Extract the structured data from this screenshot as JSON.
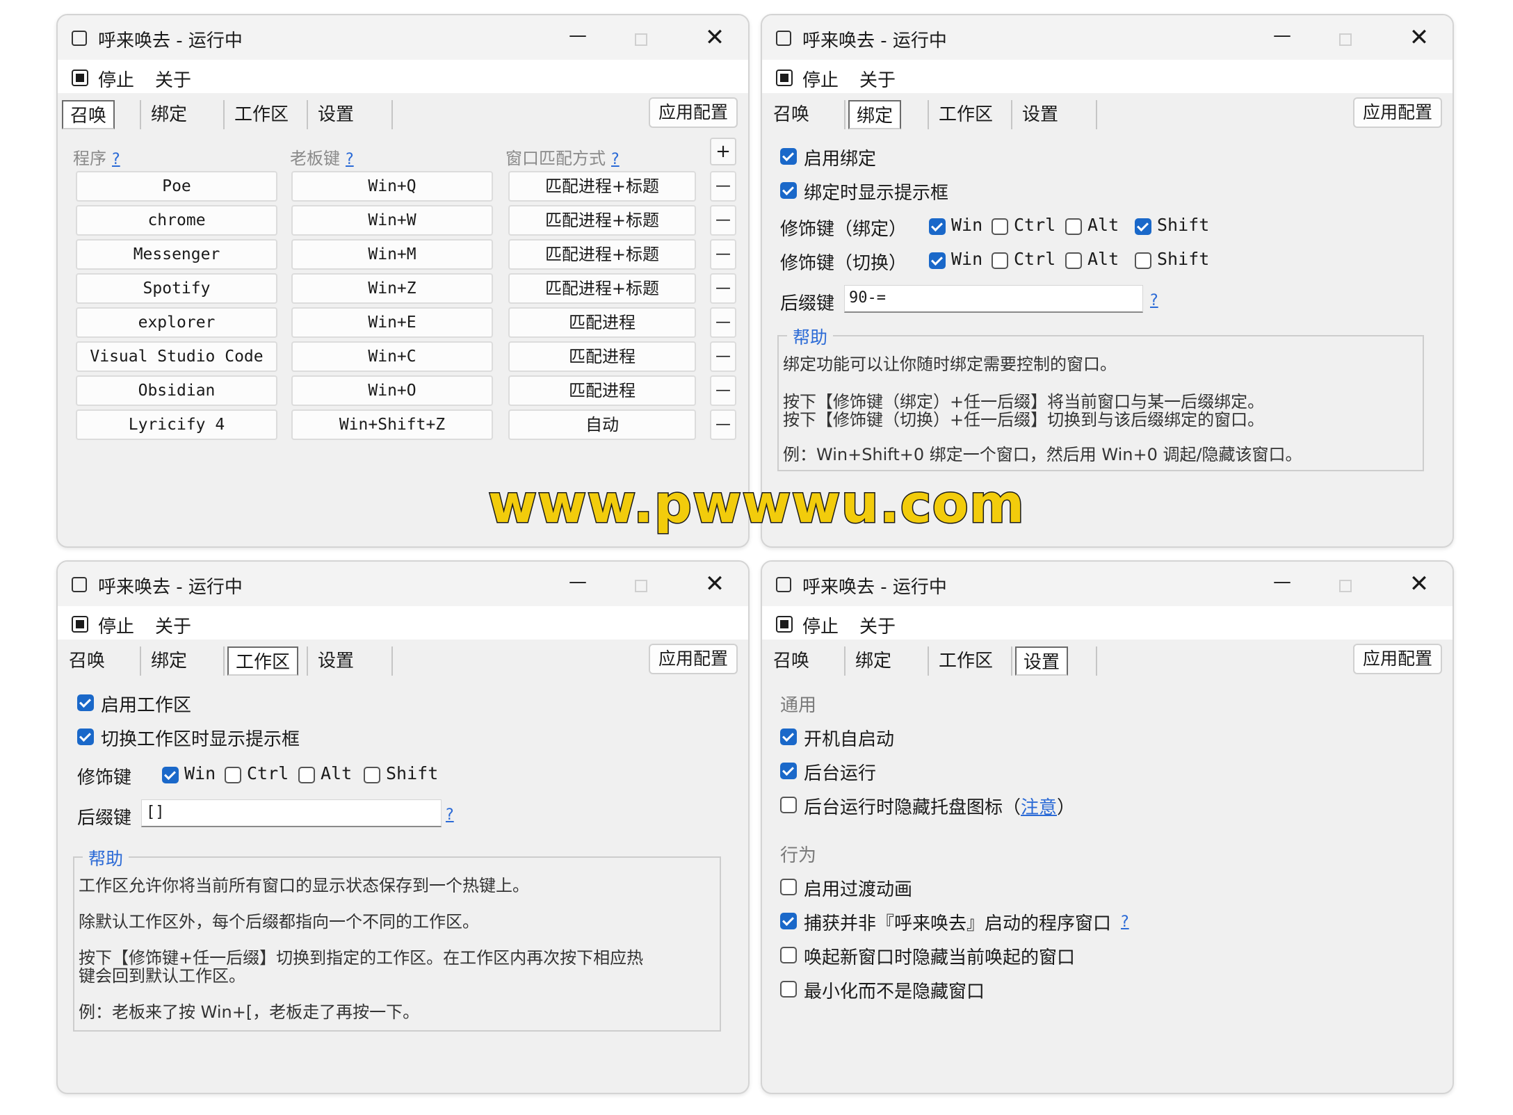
{
  "window": {
    "title": "呼来唤去 - 运行中",
    "menu": {
      "stop": "停止",
      "about": "关于"
    },
    "tabs": [
      "召唤",
      "绑定",
      "工作区",
      "设置"
    ],
    "apply_label": "应用配置",
    "min_glyph": "—",
    "close_glyph": "✕"
  },
  "summon": {
    "headers": {
      "program": "程序",
      "hotkey": "老板键",
      "match": "窗口匹配方式",
      "help": "?"
    },
    "add_label": "+",
    "delete_label": "—",
    "rows": [
      {
        "program": "Poe",
        "hotkey": "Win+Q",
        "match": "匹配进程+标题"
      },
      {
        "program": "chrome",
        "hotkey": "Win+W",
        "match": "匹配进程+标题"
      },
      {
        "program": "Messenger",
        "hotkey": "Win+M",
        "match": "匹配进程+标题"
      },
      {
        "program": "Spotify",
        "hotkey": "Win+Z",
        "match": "匹配进程+标题"
      },
      {
        "program": "explorer",
        "hotkey": "Win+E",
        "match": "匹配进程"
      },
      {
        "program": "Visual Studio Code",
        "hotkey": "Win+C",
        "match": "匹配进程"
      },
      {
        "program": "Obsidian",
        "hotkey": "Win+O",
        "match": "匹配进程"
      },
      {
        "program": "Lyricify 4",
        "hotkey": "Win+Shift+Z",
        "match": "自动"
      }
    ]
  },
  "bind": {
    "enable": {
      "label": "启用绑定",
      "checked": true
    },
    "show_tip": {
      "label": "绑定时显示提示框",
      "checked": true
    },
    "mod_bind_label": "修饰键（绑定）",
    "mod_switch_label": "修饰键（切换）",
    "mod_names": [
      "Win",
      "Ctrl",
      "Alt",
      "Shift"
    ],
    "mod_bind_checked": [
      true,
      false,
      false,
      true
    ],
    "mod_switch_checked": [
      true,
      false,
      false,
      false
    ],
    "suffix_label": "后缀键",
    "suffix_value": "90-=",
    "help_q": "?",
    "help_title": "帮助",
    "help_lines": [
      "绑定功能可以让你随时绑定需要控制的窗口。",
      "按下【修饰键（绑定）+任一后缀】将当前窗口与某一后缀绑定。",
      "按下【修饰键（切换）+任一后缀】切换到与该后缀绑定的窗口。",
      "例：Win+Shift+0 绑定一个窗口，然后用 Win+0 调起/隐藏该窗口。"
    ]
  },
  "workspace": {
    "enable": {
      "label": "启用工作区",
      "checked": true
    },
    "show_tip": {
      "label": "切换工作区时显示提示框",
      "checked": true
    },
    "mod_label": "修饰键",
    "mod_names": [
      "Win",
      "Ctrl",
      "Alt",
      "Shift"
    ],
    "mod_checked": [
      true,
      false,
      false,
      false
    ],
    "suffix_label": "后缀键",
    "suffix_value": "[]",
    "help_q": "?",
    "help_title": "帮助",
    "help_lines": [
      "工作区允许你将当前所有窗口的显示状态保存到一个热键上。",
      "除默认工作区外，每个后缀都指向一个不同的工作区。",
      "按下【修饰键+任一后缀】切换到指定的工作区。在工作区内再次按下相应热",
      "键会回到默认工作区。",
      "例：老板来了按 Win+[，老板走了再按一下。"
    ]
  },
  "settings": {
    "general_title": "通用",
    "autostart": {
      "label": "开机自启动",
      "checked": true
    },
    "background": {
      "label": "后台运行",
      "checked": true
    },
    "hide_tray": {
      "label": "后台运行时隐藏托盘图标",
      "checked": false,
      "note_open": "（",
      "note_link": "注意",
      "note_close": "）"
    },
    "behavior_title": "行为",
    "transition": {
      "label": "启用过渡动画",
      "checked": false
    },
    "capture": {
      "label": "捕获并非『呼来唤去』启动的程序窗口",
      "checked": true,
      "help_q": "?"
    },
    "hide_prev": {
      "label": "唤起新窗口时隐藏当前唤起的窗口",
      "checked": false
    },
    "minimize": {
      "label": "最小化而不是隐藏窗口",
      "checked": false
    }
  },
  "watermark": "www.pwwwu.com",
  "colors": {
    "accent": "#1a68c9",
    "link": "#2b6ad6",
    "window_bg": "#f0f0f0",
    "watermark": "#f2cc0c"
  }
}
